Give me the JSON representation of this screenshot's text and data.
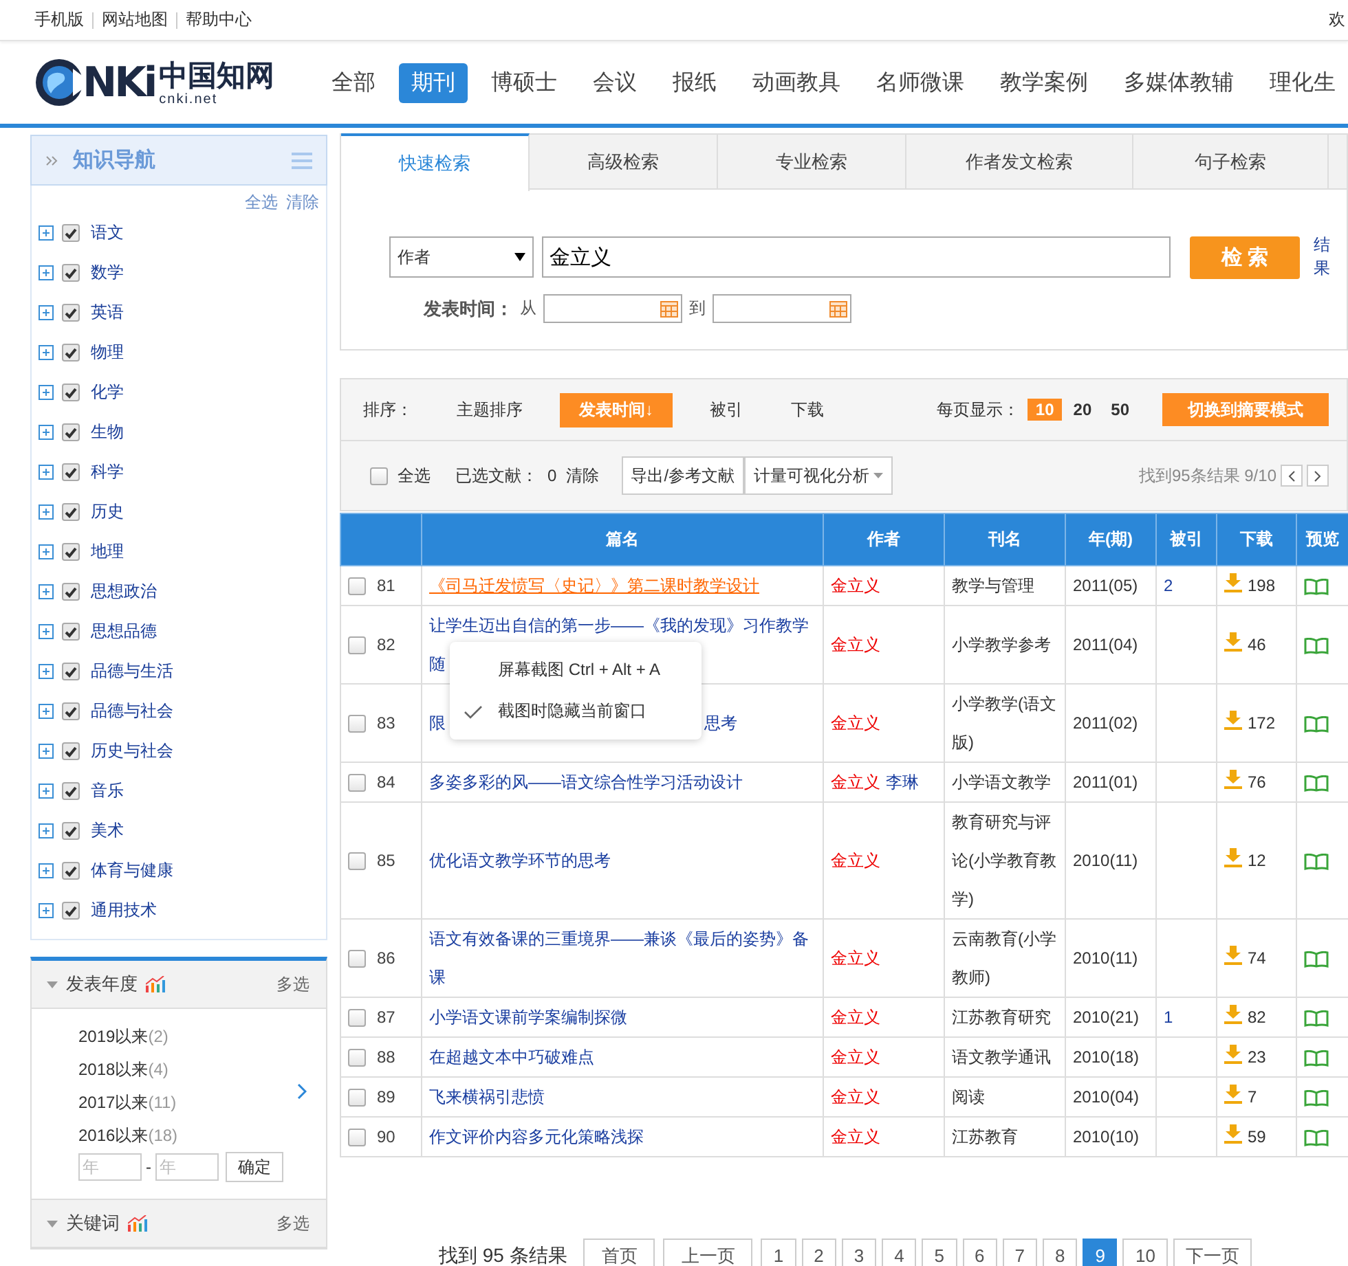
{
  "top_bar": {
    "links": [
      "手机版",
      "网站地图",
      "帮助中心"
    ],
    "welcome": "欢"
  },
  "logo": {
    "letters": "NKi",
    "name": "中国知网",
    "domain": "cnki.net"
  },
  "nav": [
    {
      "label": "全部",
      "selected": false
    },
    {
      "label": "期刊",
      "selected": true
    },
    {
      "label": "博硕士",
      "selected": false
    },
    {
      "label": "会议",
      "selected": false
    },
    {
      "label": "报纸",
      "selected": false
    },
    {
      "label": "动画教具",
      "selected": false
    },
    {
      "label": "名师微课",
      "selected": false
    },
    {
      "label": "教学案例",
      "selected": false
    },
    {
      "label": "多媒体教辅",
      "selected": false
    },
    {
      "label": "理化生",
      "selected": false
    }
  ],
  "sidebar": {
    "nav_title": "知识导航",
    "select_all": "全选",
    "clear": "清除",
    "subjects": [
      {
        "label": "语文",
        "checked": true,
        "expanded": false
      },
      {
        "label": "数学",
        "checked": true,
        "expanded": false
      },
      {
        "label": "英语",
        "checked": true,
        "expanded": false
      },
      {
        "label": "物理",
        "checked": true,
        "expanded": false
      },
      {
        "label": "化学",
        "checked": true,
        "expanded": false
      },
      {
        "label": "生物",
        "checked": true,
        "expanded": false
      },
      {
        "label": "科学",
        "checked": true,
        "expanded": false
      },
      {
        "label": "历史",
        "checked": true,
        "expanded": false
      },
      {
        "label": "地理",
        "checked": true,
        "expanded": false
      },
      {
        "label": "思想政治",
        "checked": true,
        "expanded": false
      },
      {
        "label": "思想品德",
        "checked": true,
        "expanded": false
      },
      {
        "label": "品德与生活",
        "checked": true,
        "expanded": false
      },
      {
        "label": "品德与社会",
        "checked": true,
        "expanded": false
      },
      {
        "label": "历史与社会",
        "checked": true,
        "expanded": false
      },
      {
        "label": "音乐",
        "checked": true,
        "expanded": false
      },
      {
        "label": "美术",
        "checked": true,
        "expanded": false
      },
      {
        "label": "体育与健康",
        "checked": true,
        "expanded": false
      },
      {
        "label": "通用技术",
        "checked": true,
        "expanded": false
      }
    ],
    "year_panel": {
      "title": "发表年度",
      "multi": "多选",
      "items": [
        {
          "year": "2019以来",
          "count": "(2)"
        },
        {
          "year": "2018以来",
          "count": "(4)"
        },
        {
          "year": "2017以来",
          "count": "(11)"
        },
        {
          "year": "2016以来",
          "count": "(18)"
        }
      ],
      "from_placeholder": "年",
      "dash": "-",
      "to_placeholder": "年",
      "confirm": "确定"
    },
    "keyword_panel": {
      "title": "关键词",
      "multi": "多选"
    }
  },
  "search_tabs": [
    {
      "label": "快速检索",
      "selected": true
    },
    {
      "label": "高级检索",
      "selected": false
    },
    {
      "label": "专业检索",
      "selected": false
    },
    {
      "label": "作者发文检索",
      "selected": false
    },
    {
      "label": "句子检索",
      "selected": false
    }
  ],
  "search": {
    "field": "作者",
    "value": "金立义",
    "button": "检 索",
    "result_link": "结果",
    "date_label": "发表时间：",
    "from": "从",
    "to": "到"
  },
  "sort": {
    "label": "排序：",
    "options": [
      {
        "label": "主题排序",
        "selected": false
      },
      {
        "label": "发表时间↓",
        "selected": true
      },
      {
        "label": "被引",
        "selected": false
      },
      {
        "label": "下载",
        "selected": false
      }
    ],
    "page_size_label": "每页显示：",
    "page_sizes": [
      {
        "label": "10",
        "selected": true
      },
      {
        "label": "20",
        "selected": false
      },
      {
        "label": "50",
        "selected": false
      }
    ],
    "mode_button": "切换到摘要模式"
  },
  "toolbar": {
    "select_all": {
      "label": "全选",
      "checked": false
    },
    "selected_label": "已选文献：",
    "selected_count": "0",
    "clear": "清除",
    "export_button": "导出/参考文献",
    "analysis_button": "计量可视化分析",
    "result_info": "找到95条结果 9/10"
  },
  "table": {
    "columns": [
      "篇名",
      "作者",
      "刊名",
      "年(期)",
      "被引",
      "下载",
      "预览"
    ],
    "rows": [
      {
        "checked": false,
        "number": "81",
        "title": "《司马迁发愤写〈史记〉》第二课时教学设计",
        "hovered": true,
        "authors": [
          {
            "name": "金立义",
            "matched": true
          }
        ],
        "journal": "教学与管理",
        "issue": "2011(05)",
        "citations": "2",
        "downloads": "198"
      },
      {
        "checked": false,
        "number": "82",
        "title": "让学生迈出自信的第一步——《我的发现》习作教学随",
        "hovered": false,
        "authors": [
          {
            "name": "金立义",
            "matched": true
          }
        ],
        "journal": "小学教学参考",
        "issue": "2011(04)",
        "downloads": "46"
      },
      {
        "checked": false,
        "number": "83",
        "title_parts": [
          "限",
          "思考"
        ],
        "hovered": false,
        "authors": [
          {
            "name": "金立义",
            "matched": true
          }
        ],
        "journal": "小学教学(语文版)",
        "issue": "2011(02)",
        "downloads": "172"
      },
      {
        "checked": false,
        "number": "84",
        "title": "多姿多彩的风——语文综合性学习活动设计",
        "hovered": false,
        "authors": [
          {
            "name": "金立义",
            "matched": true
          },
          {
            "name": "李琳",
            "matched": false
          }
        ],
        "journal": "小学语文教学",
        "issue": "2011(01)",
        "downloads": "76"
      },
      {
        "checked": false,
        "number": "85",
        "title": "优化语文教学环节的思考",
        "hovered": false,
        "authors": [
          {
            "name": "金立义",
            "matched": true
          }
        ],
        "journal": "教育研究与评论(小学教育教学)",
        "issue": "2010(11)",
        "downloads": "12"
      },
      {
        "checked": false,
        "number": "86",
        "title": "语文有效备课的三重境界——兼谈《最后的姿势》备课",
        "hovered": false,
        "authors": [
          {
            "name": "金立义",
            "matched": true
          }
        ],
        "journal": "云南教育(小学教师)",
        "issue": "2010(11)",
        "downloads": "74"
      },
      {
        "checked": false,
        "number": "87",
        "title": "小学语文课前学案编制探微",
        "hovered": false,
        "authors": [
          {
            "name": "金立义",
            "matched": true
          }
        ],
        "journal": "江苏教育研究",
        "issue": "2010(21)",
        "citations": "1",
        "downloads": "82"
      },
      {
        "checked": false,
        "number": "88",
        "title": "在超越文本中巧破难点",
        "hovered": false,
        "authors": [
          {
            "name": "金立义",
            "matched": true
          }
        ],
        "journal": "语文教学通讯",
        "issue": "2010(18)",
        "downloads": "23"
      },
      {
        "checked": false,
        "number": "89",
        "title": "飞来横祸引悲愤",
        "hovered": false,
        "authors": [
          {
            "name": "金立义",
            "matched": true
          }
        ],
        "journal": "阅读",
        "issue": "2010(04)",
        "downloads": "7"
      },
      {
        "checked": false,
        "number": "90",
        "title": "作文评价内容多元化策略浅探",
        "hovered": false,
        "authors": [
          {
            "name": "金立义",
            "matched": true
          }
        ],
        "journal": "江苏教育",
        "issue": "2010(10)",
        "downloads": "59"
      }
    ]
  },
  "context_menu": {
    "items": [
      {
        "label": "屏幕截图 Ctrl + Alt + A",
        "checked": false
      },
      {
        "label": "截图时隐藏当前窗口",
        "checked": true
      }
    ]
  },
  "pagination": {
    "summary": "找到 95 条结果",
    "pages": [
      {
        "label": "首页",
        "selected": false
      },
      {
        "label": "上一页",
        "selected": false
      },
      {
        "label": "1",
        "selected": false
      },
      {
        "label": "2",
        "selected": false
      },
      {
        "label": "3",
        "selected": false
      },
      {
        "label": "4",
        "selected": false
      },
      {
        "label": "5",
        "selected": false
      },
      {
        "label": "6",
        "selected": false
      },
      {
        "label": "7",
        "selected": false
      },
      {
        "label": "8",
        "selected": false
      },
      {
        "label": "9",
        "selected": true
      },
      {
        "label": "10",
        "selected": false
      },
      {
        "label": "下一页",
        "selected": false
      }
    ]
  }
}
